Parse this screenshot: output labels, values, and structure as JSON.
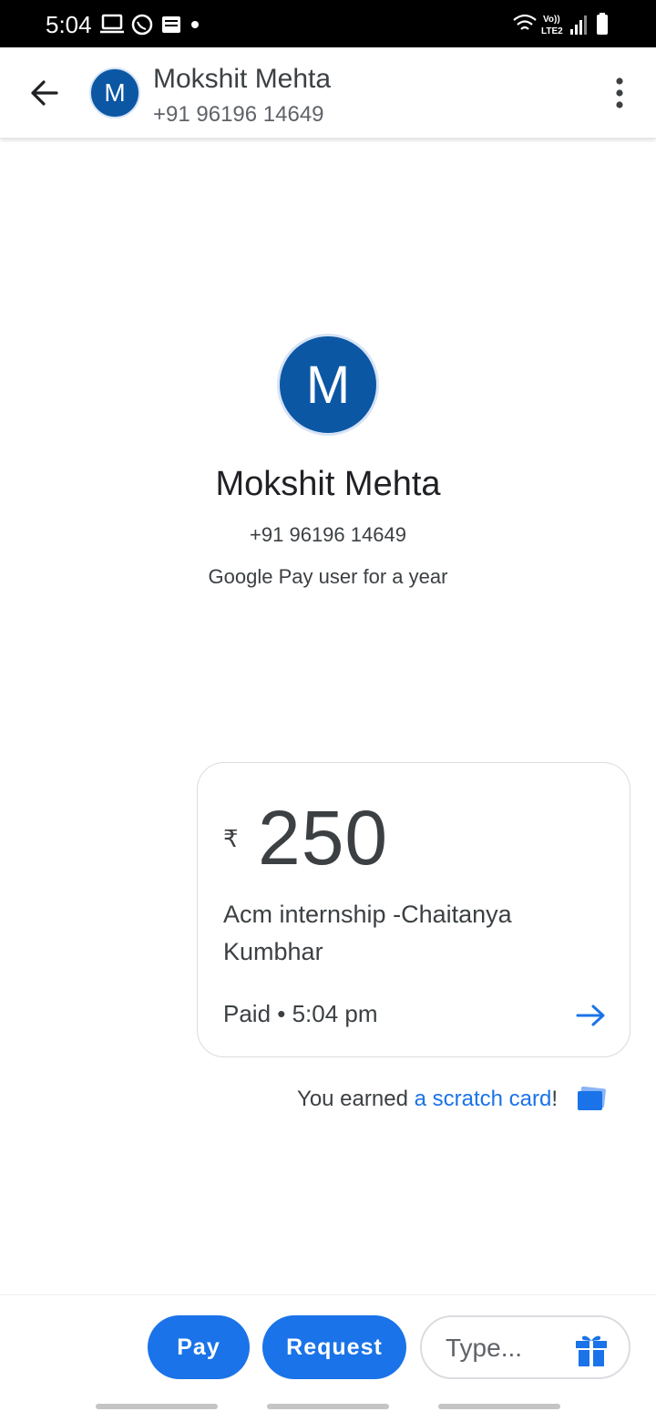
{
  "status_bar": {
    "time": "5:04",
    "left_icons": [
      "laptop-icon",
      "whatsapp-icon",
      "news-icon",
      "dot-icon"
    ],
    "right_icons": [
      "wifi-icon",
      "volte-icon",
      "signal-icon",
      "battery-icon"
    ],
    "volte_label": "Vo))",
    "lte_label": "LTE2"
  },
  "header": {
    "avatar_letter": "M",
    "name": "Mokshit Mehta",
    "phone": "+91 96196 14649"
  },
  "profile": {
    "avatar_letter": "M",
    "name": "Mokshit Mehta",
    "phone": "+91 96196 14649",
    "tenure": "Google Pay user for a year"
  },
  "payment": {
    "currency": "₹",
    "amount": "250",
    "note": "Acm internship -Chaitanya Kumbhar",
    "status": "Paid • 5:04 pm"
  },
  "reward": {
    "prefix": "You earned ",
    "link": "a scratch card",
    "suffix": "!"
  },
  "actions": {
    "pay_label": "Pay",
    "request_label": "Request",
    "message_placeholder": "Type..."
  },
  "colors": {
    "accent": "#1a73e8",
    "avatar": "#0b57a4"
  }
}
